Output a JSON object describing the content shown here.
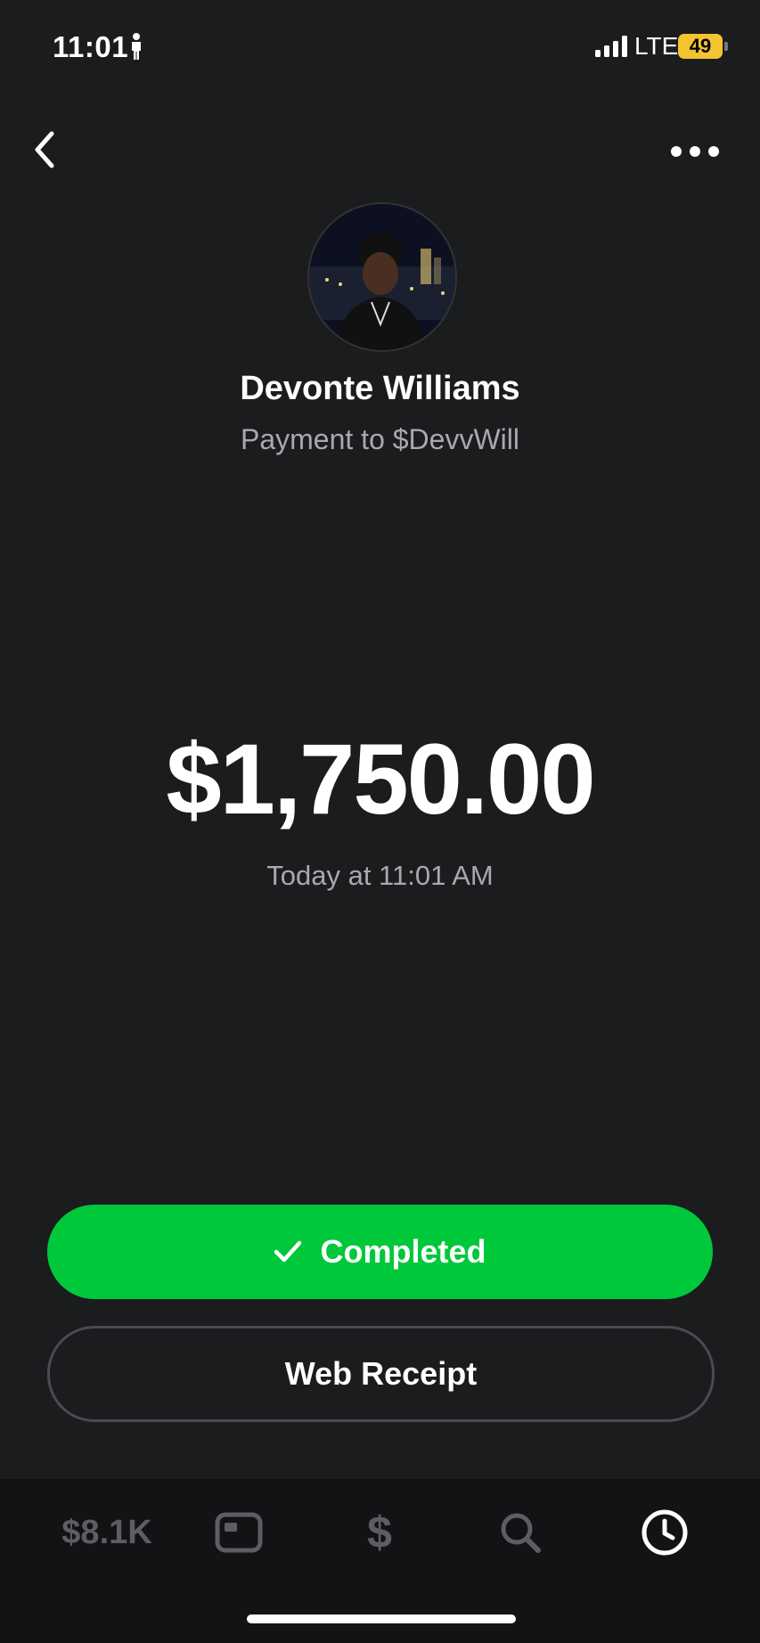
{
  "status_bar": {
    "time": "11:01",
    "network": "LTE",
    "battery": "49"
  },
  "header": {
    "back_icon": "chevron-left-icon",
    "more_icon": "ellipsis-icon"
  },
  "recipient": {
    "name": "Devonte Williams",
    "subtitle": "Payment to $DevvWill",
    "avatar": "avatar-photo"
  },
  "payment": {
    "amount": "$1,750.00",
    "timestamp": "Today at 11:01 AM"
  },
  "actions": {
    "completed_label": "Completed",
    "receipt_label": "Web Receipt"
  },
  "tab_bar": {
    "balance_label": "$8.1K",
    "pay_label": "$",
    "items": [
      "balance",
      "card-icon",
      "pay",
      "search-icon",
      "activity-clock-icon"
    ]
  },
  "colors": {
    "background": "#1b1c1e",
    "accent_green": "#00c83b",
    "secondary_text": "#a9a9ad",
    "tab_inactive": "#5d5e61"
  }
}
